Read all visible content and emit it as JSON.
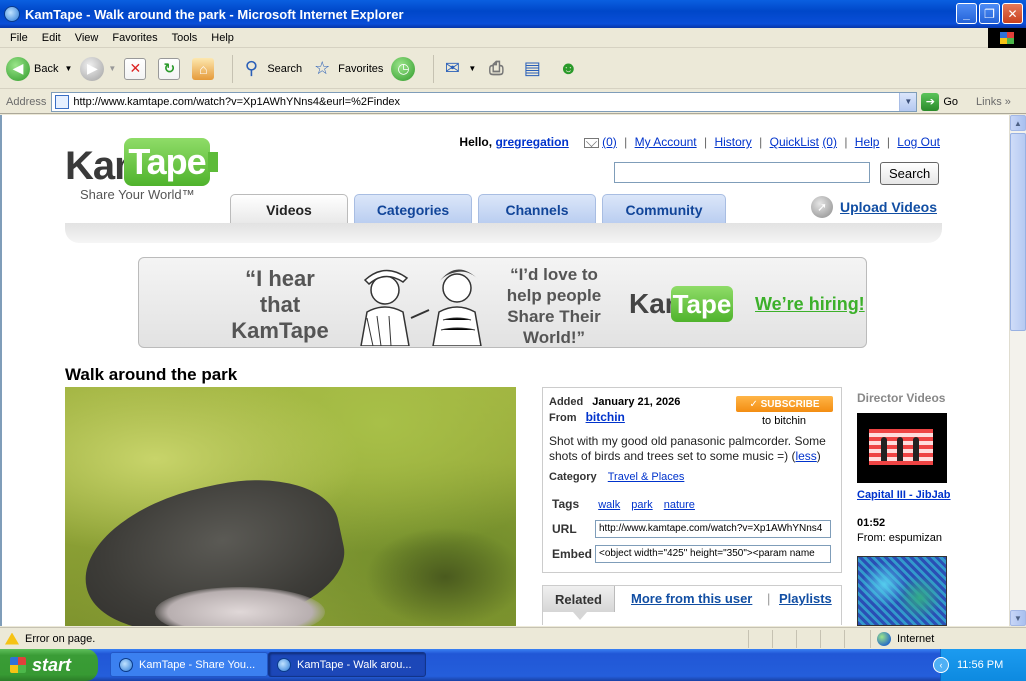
{
  "window": {
    "title": "KamTape - Walk around the park - Microsoft Internet Explorer",
    "controls": [
      "_",
      "❐",
      "✕"
    ]
  },
  "menu": [
    "File",
    "Edit",
    "View",
    "Favorites",
    "Tools",
    "Help"
  ],
  "toolbar": {
    "back": "Back",
    "search": "Search",
    "favorites": "Favorites"
  },
  "address": {
    "label": "Address",
    "url": "http://www.kamtape.com/watch?v=Xp1AWhYNns4&eurl=%2Findex",
    "go": "Go",
    "links": "Links"
  },
  "site": {
    "logo_left": "Kam",
    "logo_right": "Tape",
    "tagline": "Share Your World™",
    "hello": "Hello,",
    "username": "gregregation",
    "inbox_count": "(0)",
    "links": {
      "my_account": "My Account",
      "history": "History",
      "quicklist": "QuickList",
      "quicklist_count": "(0)",
      "help": "Help",
      "logout": "Log Out"
    },
    "search_button": "Search",
    "tabs": [
      "Videos",
      "Categories",
      "Channels",
      "Community"
    ],
    "upload": "Upload Videos"
  },
  "banner": {
    "quote1": "“I hear that KamTape is hiring!”",
    "quote2": "“I’d love to help people Share Their World!”",
    "logo_left": "Kam",
    "logo_right": "Tape",
    "cta": "We’re hiring!"
  },
  "video": {
    "title": "Walk around the park",
    "added_label": "Added",
    "added": "January 21, 2026",
    "from_label": "From",
    "author": "bitchin",
    "subscribe": "✓ SUBSCRIBE",
    "subscribe_to": "to bitchin",
    "description": "Shot with my good old panasonic palmcorder. Some shots of birds and trees set to some music =)",
    "less": "less",
    "category_label": "Category",
    "category": "Travel & Places",
    "tags_label": "Tags",
    "tags": [
      "walk",
      "park",
      "nature"
    ],
    "url_label": "URL",
    "url": "http://www.kamtape.com/watch?v=Xp1AWhYNns4",
    "embed_label": "Embed",
    "embed": "<object width=\"425\" height=\"350\"><param name"
  },
  "related": {
    "tab": "Related",
    "more": "More from this user",
    "playlists": "Playlists"
  },
  "director": {
    "heading": "Director Videos",
    "title": "Capital III - JibJab",
    "duration": "01:52",
    "from": "From: espumizan"
  },
  "status": {
    "message": "Error on page.",
    "zone": "Internet"
  },
  "taskbar": {
    "start": "start",
    "items": [
      "KamTape - Share You...",
      "KamTape - Walk arou..."
    ],
    "clock": "11:56 PM"
  }
}
